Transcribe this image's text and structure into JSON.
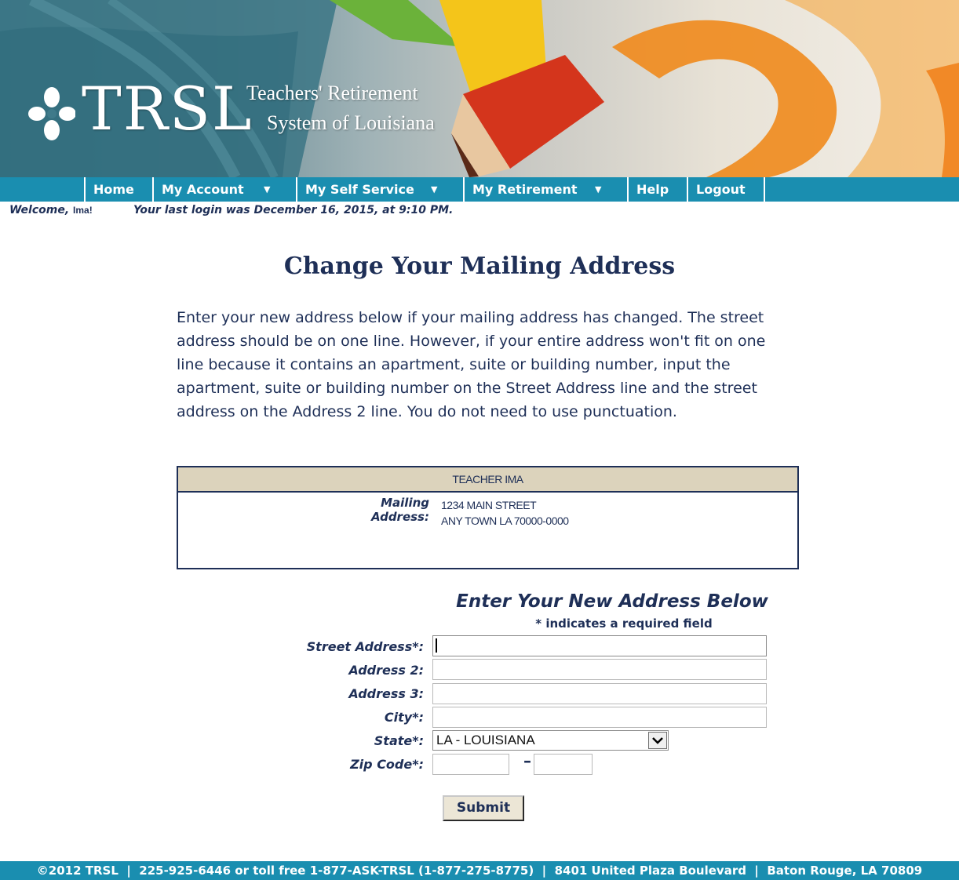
{
  "header": {
    "logo_text": "TRSL",
    "logo_line1": "Teachers' Retirement",
    "logo_line2": "System of Louisiana"
  },
  "nav": {
    "items": [
      {
        "label": "Home"
      },
      {
        "label": "My Account",
        "caret": "▼"
      },
      {
        "label": "My Self Service",
        "caret": "▼"
      },
      {
        "label": "My Retirement",
        "caret": "▼"
      },
      {
        "label": "Help"
      },
      {
        "label": "Logout"
      }
    ]
  },
  "welcome": {
    "prefix": "Welcome,",
    "name": "Ima!",
    "last_login": "Your last login was December 16, 2015, at 9:10 PM."
  },
  "page": {
    "title": "Change Your Mailing Address",
    "intro": "Enter your new address below if your mailing address has changed. The street address should be on one line. However, if your entire address won't fit on one line because it contains an apartment, suite or building number, input the apartment, suite or building number on the Street Address line and the street address on the Address 2 line. You do not need to use punctuation."
  },
  "current_address": {
    "name": "TEACHER IMA",
    "label": "Mailing Address:",
    "line1": "1234 MAIN STREET",
    "line2": "ANY TOWN LA 70000-0000"
  },
  "form": {
    "heading": "Enter Your New Address Below",
    "required_note": "* indicates a required field",
    "street_label": "Street Address*:",
    "street_value": "",
    "address2_label": "Address 2:",
    "address2_value": "",
    "address3_label": "Address 3:",
    "address3_value": "",
    "city_label": "City*:",
    "city_value": "",
    "state_label": "State*:",
    "state_value": "LA - LOUISIANA",
    "zip_label": "Zip Code*:",
    "zip_value": "",
    "zip_ext_value": "",
    "zip_separator": "–",
    "submit_label": "Submit"
  },
  "footer": {
    "text": "©2012 TRSL  |  225-925-6446 or toll free 1-877-ASK-TRSL (1-877-275-8775)  |  8401 United Plaza Boulevard  |  Baton Rouge, LA 70809"
  },
  "colors": {
    "nav_bg": "#1a8eb0",
    "text_navy": "#1e2f57",
    "address_header_bg": "#dcd3bc"
  },
  "icons": {
    "logo_mark": "trsl-fleur-icon",
    "dropdown": "chevron-down-icon"
  }
}
